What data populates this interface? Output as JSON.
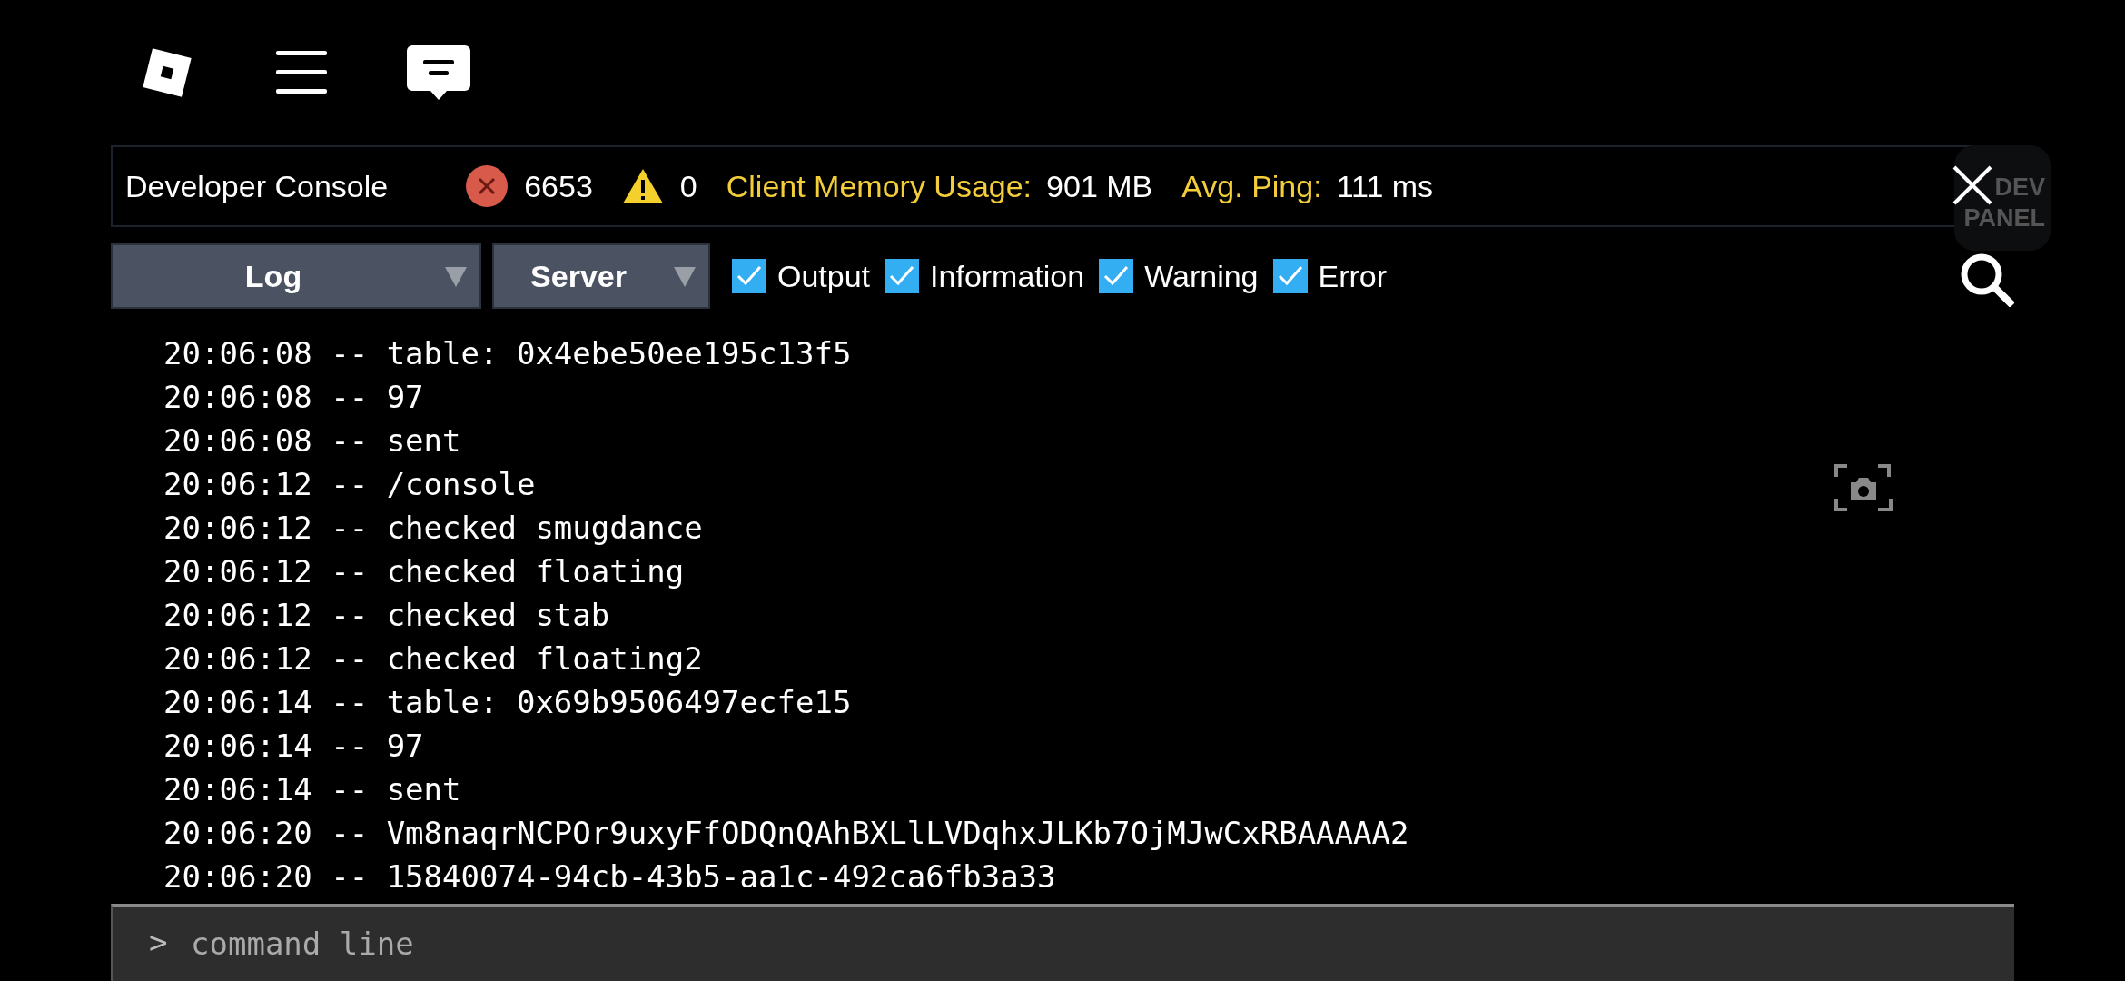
{
  "console": {
    "title": "Developer Console",
    "error_count": "6653",
    "warning_count": "0",
    "stats": [
      {
        "label": "Client Memory Usage:",
        "value": "901 MB"
      },
      {
        "label": "Avg. Ping:",
        "value": "111 ms"
      }
    ]
  },
  "dev_panel_button": {
    "label": "DEV PANEL"
  },
  "filters": {
    "dropdowns": [
      {
        "label": "Log"
      },
      {
        "label": "Server"
      }
    ],
    "checkboxes": [
      {
        "label": "Output",
        "checked": true
      },
      {
        "label": "Information",
        "checked": true
      },
      {
        "label": "Warning",
        "checked": true
      },
      {
        "label": "Error",
        "checked": true
      }
    ]
  },
  "log": [
    "20:06:08 -- table: 0x4ebe50ee195c13f5",
    "20:06:08 -- 97",
    "20:06:08 -- sent",
    "20:06:12 -- /console",
    "20:06:12 -- checked smugdance",
    "20:06:12 -- checked floating",
    "20:06:12 -- checked stab",
    "20:06:12 -- checked floating2",
    "20:06:14 -- table: 0x69b9506497ecfe15",
    "20:06:14 -- 97",
    "20:06:14 -- sent",
    "20:06:20 -- Vm8naqrNCPOr9uxyFfODQnQAhBXLlLVDqhxJLKb7OjMJwCxRBAAAAA2",
    "20:06:20 -- 15840074-94cb-43b5-aa1c-492ca6fb3a33"
  ],
  "command_line": {
    "prompt": ">",
    "placeholder": "command line"
  }
}
